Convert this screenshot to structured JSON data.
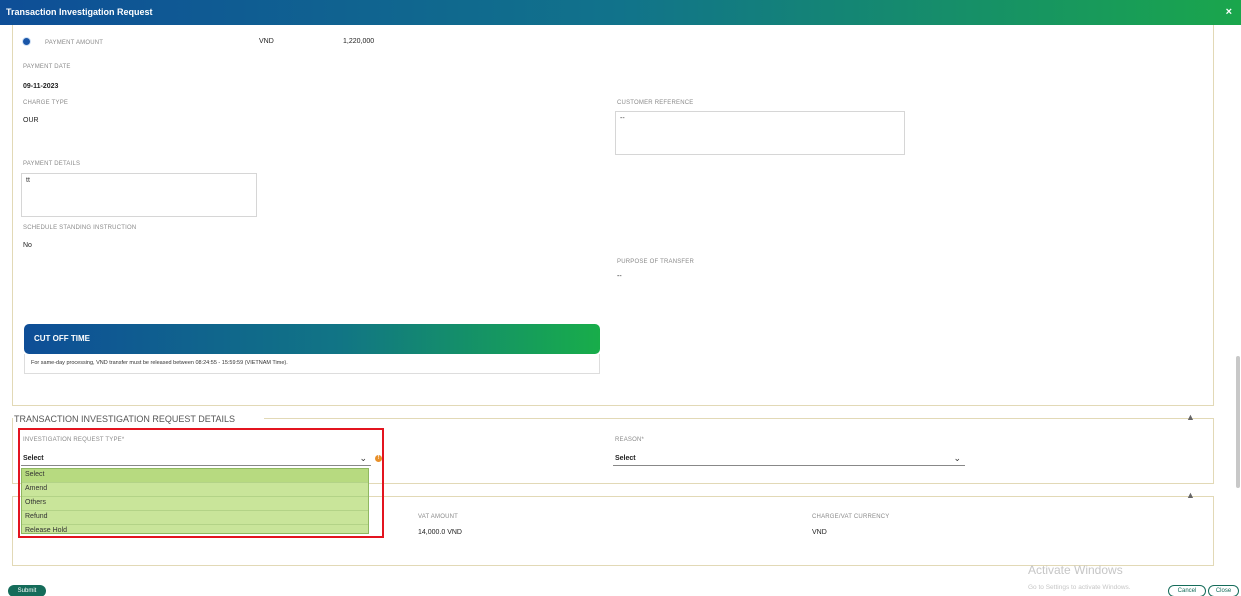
{
  "window": {
    "title": "Transaction Investigation Request",
    "close_symbol": "×"
  },
  "payment": {
    "amount_label": "PAYMENT AMOUNT",
    "amount_currency": "VND",
    "amount_value": "1,220,000",
    "date_label": "PAYMENT DATE",
    "date_value": "09-11-2023",
    "charge_type_label": "CHARGE TYPE",
    "charge_type_value": "OUR",
    "customer_reference_label": "CUSTOMER REFERENCE",
    "customer_reference_value": "--",
    "details_label": "PAYMENT DETAILS",
    "details_value": "tt",
    "standing_instruction_label": "SCHEDULE STANDING INSTRUCTION",
    "standing_instruction_value": "No",
    "purpose_label": "PURPOSE OF TRANSFER",
    "purpose_value": "--"
  },
  "cutoff": {
    "title": "CUT OFF TIME",
    "text": "For same-day processing, VND transfer must be released between 08:24:55 - 15:59:59 (VIETNAM Time)."
  },
  "investigation": {
    "section_title": "TRANSACTION INVESTIGATION REQUEST DETAILS",
    "type_label": "INVESTIGATION REQUEST TYPE*",
    "type_value": "Select",
    "reason_label": "REASON*",
    "reason_value": "Select",
    "options": [
      "Select",
      "Amend",
      "Others",
      "Refund",
      "Release Hold"
    ]
  },
  "charges": {
    "vat_label": "VAT AMOUNT",
    "vat_value": "14,000.0 VND",
    "currency_label": "CHARGE/VAT CURRENCY",
    "currency_value": "VND"
  },
  "actions": {
    "submit": "Submit",
    "cancel": "Cancel",
    "close": "Close"
  },
  "watermark": {
    "line1": "Activate Windows",
    "line2": "Go to Settings to activate Windows."
  },
  "colors": {
    "brand_blue": "#0e4e97",
    "brand_green": "#1aa64c",
    "highlight_red": "#e3141f",
    "dropdown_bg": "#c9e59a"
  }
}
